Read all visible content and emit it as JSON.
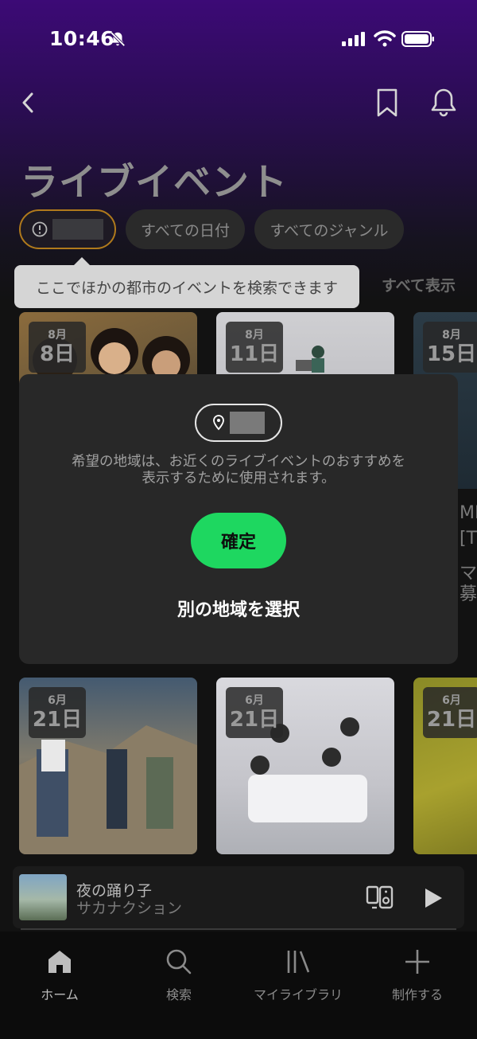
{
  "status_bar": {
    "time": "10:46",
    "icons": [
      "bell-slash-icon",
      "signal-icon",
      "wifi-icon",
      "battery-icon"
    ]
  },
  "header": {
    "back_icon": "chevron-left-icon",
    "bookmark_icon": "bookmark-icon",
    "notification_icon": "bell-icon",
    "title": "ライブイベント"
  },
  "filters": {
    "location_chip": {
      "icon": "alert-circle-icon",
      "value": ""
    },
    "date_chip": "すべての日付",
    "genre_chip": "すべてのジャンル"
  },
  "tooltip": {
    "text": "ここでほかの都市のイベントを検索できます"
  },
  "show_all": "すべて表示",
  "row1_cards": [
    {
      "month": "8月",
      "day": "8日"
    },
    {
      "month": "8月",
      "day": "11日"
    },
    {
      "month": "8月",
      "day": "15日"
    }
  ],
  "row1_side_text": [
    "ME",
    "[T",
    "マリ",
    "募張"
  ],
  "modal": {
    "location_icon": "map-pin-icon",
    "location_value": "",
    "description_line1": "希望の地域は、お近くのライブイベントのおすすめを",
    "description_line2": "表示するために使用されます。",
    "confirm_label": "確定",
    "other_region_label": "別の地域を選択"
  },
  "row2_cards": [
    {
      "month": "6月",
      "day": "21日"
    },
    {
      "month": "6月",
      "day": "21日"
    },
    {
      "month": "6月",
      "day": "21日"
    }
  ],
  "mini_player": {
    "song": "夜の踊り子",
    "artist": "サカナクション",
    "device_icon": "speaker-device-icon",
    "play_icon": "play-icon",
    "progress": 0
  },
  "bottom_nav": [
    {
      "label": "ホーム",
      "icon": "home-icon",
      "active": true
    },
    {
      "label": "検索",
      "icon": "search-icon",
      "active": false
    },
    {
      "label": "マイライブラリ",
      "icon": "library-icon",
      "active": false
    },
    {
      "label": "制作する",
      "icon": "plus-icon",
      "active": false
    }
  ],
  "colors": {
    "accent_green": "#1ed760",
    "location_chip_border": "#b07a1c",
    "header_purple": "#3c0a76"
  }
}
